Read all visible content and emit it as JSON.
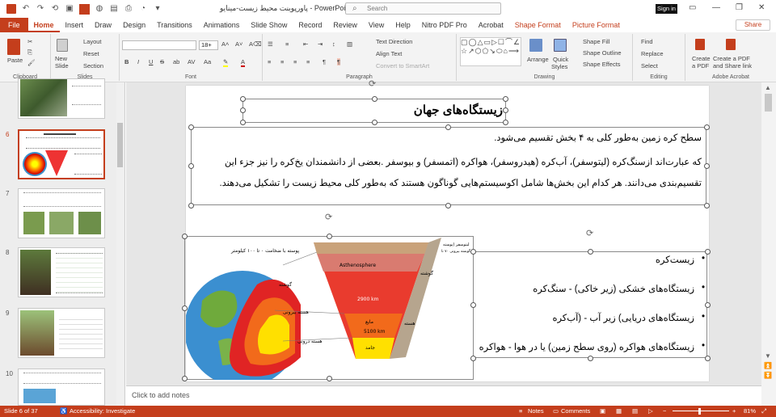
{
  "window": {
    "title": "پاورپوینت محیط زیست-مینایو  -  PowerPoint",
    "search_placeholder": "Search",
    "signin_label": "Sign in"
  },
  "tabs": [
    "File",
    "Home",
    "Insert",
    "Draw",
    "Design",
    "Transitions",
    "Animations",
    "Slide Show",
    "Record",
    "Review",
    "View",
    "Help",
    "Nitro PDF Pro",
    "Acrobat",
    "Shape Format",
    "Picture Format"
  ],
  "share_label": "Share",
  "ribbon": {
    "clipboard": {
      "paste": "Paste",
      "label": "Clipboard"
    },
    "slides": {
      "new_slide_line1": "New",
      "new_slide_line2": "Slide",
      "layout": "Layout",
      "reset": "Reset",
      "section": "Section",
      "label": "Slides"
    },
    "font": {
      "size": "18+",
      "label": "Font"
    },
    "paragraph": {
      "text_direction": "Text Direction",
      "align_text": "Align Text",
      "convert_smartart": "Convert to SmartArt",
      "label": "Paragraph"
    },
    "drawing": {
      "arrange": "Arrange",
      "quick_styles_line1": "Quick",
      "quick_styles_line2": "Styles",
      "shape_fill": "Shape Fill",
      "shape_outline": "Shape Outline",
      "shape_effects": "Shape Effects",
      "label": "Drawing"
    },
    "editing": {
      "find": "Find",
      "replace": "Replace",
      "select": "Select",
      "label": "Editing"
    },
    "adobe": {
      "create_pdf_line1": "Create",
      "create_pdf_line2": "a PDF",
      "create_share_line1": "Create a PDF",
      "create_share_line2": "and Share link",
      "label": "Adobe Acrobat"
    }
  },
  "thumbnails": [
    "6",
    "7",
    "8",
    "9",
    "10"
  ],
  "slide": {
    "title": "زیستگاه‌های جهان",
    "para1": "سطح کره زمین به‌طور کلی به ۴ بخش تقسیم می‌شود.",
    "para2": "که عبارت‌اند ازسنگ‌کره (لیتوسفر)، آب‌کره (هیدروسفر)، هواکره (اتمسفر) و بیوسفر .بعضی از دانشمندان یخ‌کره را نیز جزء این تقسیم‌بندی می‌دانند. هر کدام این بخش‌ها شامل اکوسیستم‌هایی گوناگون هستند که به‌طور کلی محیط زیست را تشکیل می‌دهند.",
    "list": [
      "زیست‌کره",
      "زیستگاه‌های خشکی (زیر خاکی) - سنگ‌کره",
      "زیستگاه‌های دریایی) زیر آب - (آب‌کره",
      "زیستگاه‌های هواکره (روی سطح زمین) یا در هوا - هواکره"
    ],
    "diagram_labels": {
      "crust_note": "پوسته با ضخامت ۰ تا ۱۰۰ کیلومتر",
      "mantle": "گوشته",
      "outer_core": "هسته بیرونی",
      "inner_core": "هسته درونی",
      "litho_note": "لیتوسفر (پوسته",
      "litho_note2": "گوشته بیرونی ۷۰ تا",
      "asthenosphere": "Asthenosphere",
      "mantle_right": "گوشته",
      "depth_2900": "2900 km",
      "depth_5100": "5100 km",
      "liquid": "مایع",
      "solid": "جامد",
      "core_right": "هسته"
    }
  },
  "notes_placeholder": "Click to add notes",
  "status": {
    "slide_info": "Slide 6 of 37",
    "accessibility": "Accessibility: Investigate",
    "notes": "Notes",
    "comments": "Comments",
    "zoom": "81%"
  }
}
